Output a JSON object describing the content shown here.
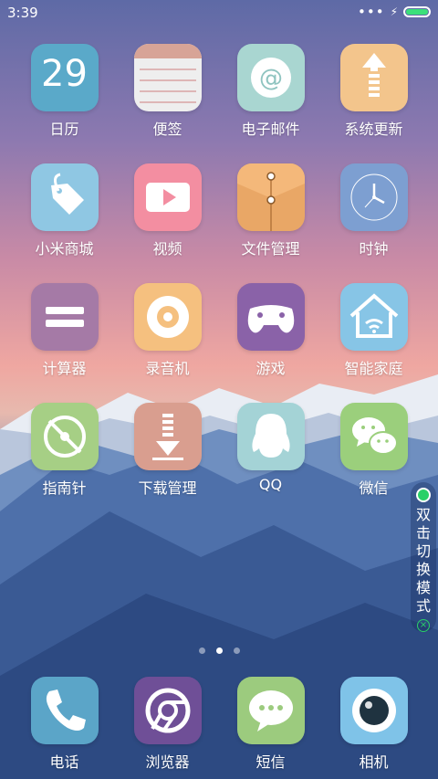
{
  "status_bar": {
    "time": "3:39",
    "more": "•••",
    "charging": "⚡",
    "battery_level": 1.0,
    "battery_color": "#3be07a"
  },
  "apps": [
    {
      "label": "日历",
      "icon": "calendar-icon",
      "day": "29"
    },
    {
      "label": "便签",
      "icon": "notes-icon"
    },
    {
      "label": "电子邮件",
      "icon": "email-icon",
      "glyph": "@"
    },
    {
      "label": "系统更新",
      "icon": "update-icon"
    },
    {
      "label": "小米商城",
      "icon": "shop-tag-icon"
    },
    {
      "label": "视频",
      "icon": "video-play-icon"
    },
    {
      "label": "文件管理",
      "icon": "file-folder-icon"
    },
    {
      "label": "时钟",
      "icon": "clock-icon"
    },
    {
      "label": "计算器",
      "icon": "calculator-icon"
    },
    {
      "label": "录音机",
      "icon": "recorder-icon"
    },
    {
      "label": "游戏",
      "icon": "gamepad-icon"
    },
    {
      "label": "智能家庭",
      "icon": "smart-home-icon"
    },
    {
      "label": "指南针",
      "icon": "compass-icon"
    },
    {
      "label": "下载管理",
      "icon": "download-icon"
    },
    {
      "label": "QQ",
      "icon": "qq-penguin-icon"
    },
    {
      "label": "微信",
      "icon": "wechat-icon"
    }
  ],
  "dock": [
    {
      "label": "电话",
      "icon": "phone-icon"
    },
    {
      "label": "浏览器",
      "icon": "browser-icon"
    },
    {
      "label": "短信",
      "icon": "message-icon"
    },
    {
      "label": "相机",
      "icon": "camera-icon"
    }
  ],
  "pager": {
    "pages": 3,
    "current": 2
  },
  "side_panel": {
    "text": "双击切换模式",
    "close_glyph": "×"
  }
}
